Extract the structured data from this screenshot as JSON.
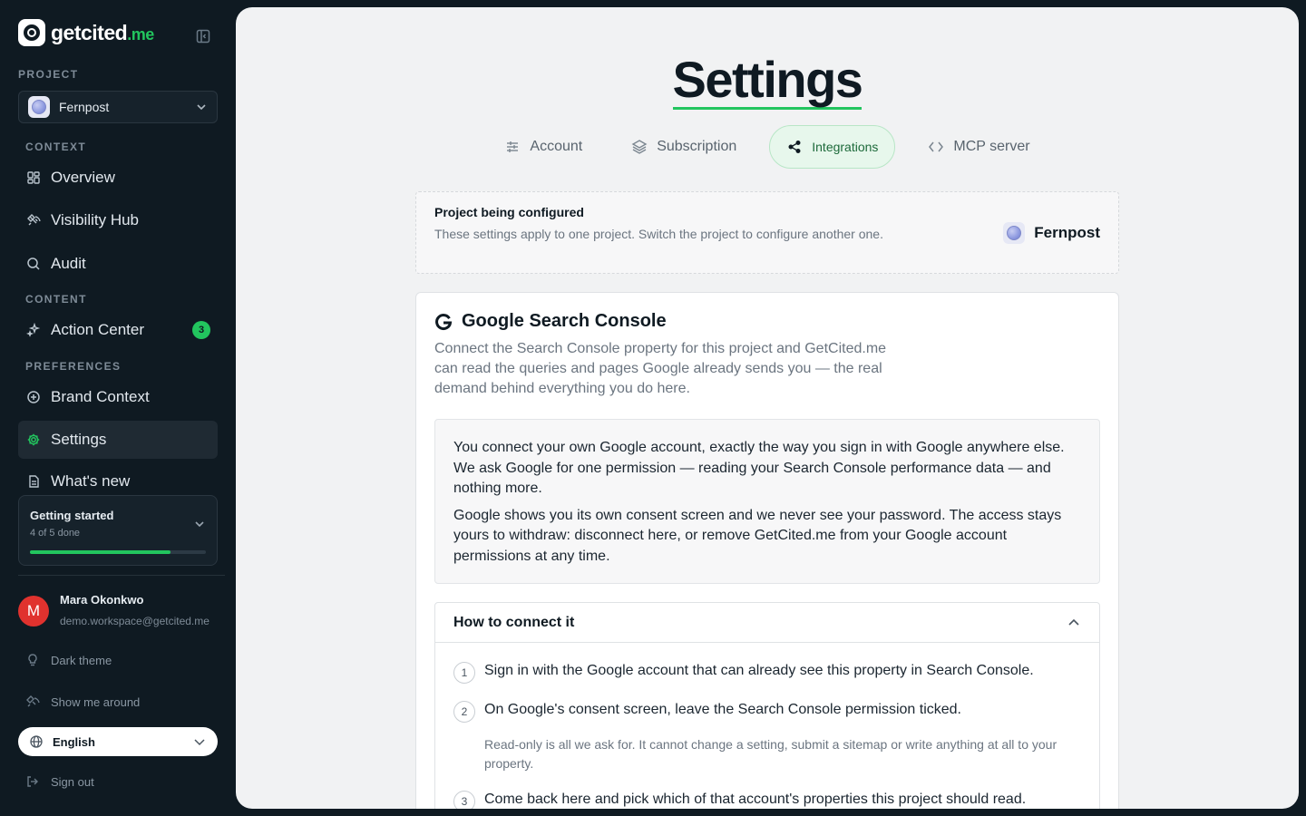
{
  "brand": {
    "name_main": "getcited",
    "name_tld": ".me"
  },
  "sidebar": {
    "project_label": "PROJECT",
    "project_name": "Fernpost",
    "context_label": "CONTEXT",
    "content_label": "CONTENT",
    "preferences_label": "PREFERENCES",
    "items": [
      {
        "label": "Overview",
        "icon": "grid-icon"
      },
      {
        "label": "Visibility Hub",
        "icon": "satellite-icon"
      },
      {
        "label": "Audit",
        "icon": "search-icon"
      },
      {
        "label": "Action Center",
        "icon": "sparkles-icon",
        "badge": "3"
      },
      {
        "label": "Brand Context",
        "icon": "plus-circle-icon"
      },
      {
        "label": "Settings",
        "icon": "gear-icon",
        "active": true
      },
      {
        "label": "What's new",
        "icon": "document-icon"
      }
    ],
    "getting_started": {
      "title": "Getting started",
      "progress_text": "4 of 5 done",
      "progress": 0.8
    },
    "user": {
      "initial": "M",
      "name": "Mara Okonkwo",
      "email": "demo.workspace@getcited.me"
    },
    "dark_theme": "Dark theme",
    "show_around": "Show me around",
    "language": "English",
    "sign_out": "Sign out"
  },
  "main": {
    "title": "Settings",
    "tabs": [
      {
        "label": "Account",
        "icon": "sliders-icon"
      },
      {
        "label": "Subscription",
        "icon": "layers-icon"
      },
      {
        "label": "Integrations",
        "icon": "share-icon",
        "active": true
      },
      {
        "label": "MCP server",
        "icon": "code-icon"
      }
    ],
    "project_card": {
      "title": "Project being configured",
      "description": "These settings apply to one project. Switch the project to configure another one.",
      "project_name": "Fernpost"
    },
    "gsc": {
      "title": "Google Search Console",
      "description": "Connect the Search Console property for this project and GetCited.me can read the queries and pages Google already sends you — the real demand behind everything you do here.",
      "info_p1": "You connect your own Google account, exactly the way you sign in with Google anywhere else. We ask Google for one permission — reading your Search Console performance data — and nothing more.",
      "info_p2": "Google shows you its own consent screen and we never see your password. The access stays yours to withdraw: disconnect here, or remove GetCited.me from your Google account permissions at any time.",
      "howto_title": "How to connect it",
      "steps": [
        {
          "num": "1",
          "text": "Sign in with the Google account that can already see this property in Search Console."
        },
        {
          "num": "2",
          "text": "On Google's consent screen, leave the Search Console permission ticked.",
          "note": "Read-only is all we ask for. It cannot change a setting, submit a sitemap or write anything at all to your property."
        },
        {
          "num": "3",
          "text": "Come back here and pick which of that account's properties this project should read."
        }
      ]
    }
  },
  "colors": {
    "accent": "#22c55e",
    "sidebar_bg": "#0f1a22",
    "main_bg": "#f1f2f3"
  }
}
